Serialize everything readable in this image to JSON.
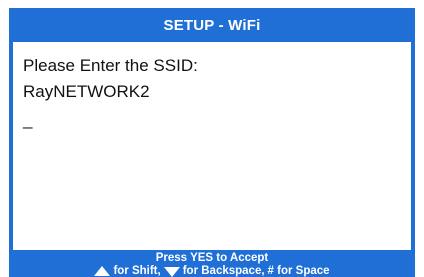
{
  "window": {
    "title": "SETUP - WiFi"
  },
  "screen": {
    "prompt": "Please Enter the SSID:",
    "ssid_value": "RayNETWORK2",
    "cursor": "_"
  },
  "footer": {
    "accept_hint": "Press YES to Accept",
    "shift_hint": "for Shift,",
    "backspace_hint": "for Backspace,",
    "space_hint": "# for Space"
  },
  "colors": {
    "frame": "#1f6fd6",
    "screen_bg": "#ffffff",
    "text": "#111111",
    "header_text": "#ffffff"
  },
  "icons": {
    "shift": "arrow-up-triangle-icon",
    "backspace": "arrow-down-triangle-icon"
  }
}
